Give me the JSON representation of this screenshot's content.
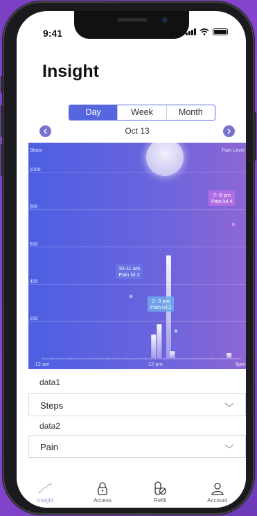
{
  "status": {
    "time": "9:41"
  },
  "page": {
    "title": "Insight"
  },
  "segment": {
    "items": [
      "Day",
      "Week",
      "Month"
    ],
    "selected": "Day"
  },
  "date": {
    "label": "Oct 13",
    "prev_icon": "chevron-left-icon",
    "next_icon": "chevron-right-icon"
  },
  "chart_data": {
    "type": "bar",
    "ylabel": "Steps",
    "y2label": "Pain Level",
    "ylim": [
      0,
      1100
    ],
    "y_ticks": [
      "1000",
      "800",
      "600",
      "400",
      "200"
    ],
    "x_ticks": [
      "12 am",
      "12 pm",
      "9pm"
    ],
    "series": [
      {
        "name": "Steps",
        "x_hours": [
          11.8,
          12.4,
          13.4,
          13.8,
          19.8
        ],
        "values": [
          130,
          185,
          555,
          40,
          30
        ]
      }
    ],
    "annotations": [
      {
        "line1": "10-11 am",
        "line2": "Pain lvl 2"
      },
      {
        "line1": "2 -3 pm",
        "line2": "Pain lvl 1"
      },
      {
        "line1": "7- 8 pm",
        "line2": "Pain lvl 4"
      }
    ],
    "colors": {
      "gradient_start": "#4d5fe2",
      "gradient_end": "#8d66d4"
    }
  },
  "data1": {
    "label": "data1",
    "value": "Steps"
  },
  "data2": {
    "label": "data2",
    "value": "Pain"
  },
  "tabs": [
    {
      "label": "Insight",
      "icon": "insight-icon",
      "active": true
    },
    {
      "label": "Access",
      "icon": "lock-icon",
      "active": false
    },
    {
      "label": "Refill",
      "icon": "pill-icon",
      "active": false
    },
    {
      "label": "Account",
      "icon": "user-icon",
      "active": false
    }
  ]
}
